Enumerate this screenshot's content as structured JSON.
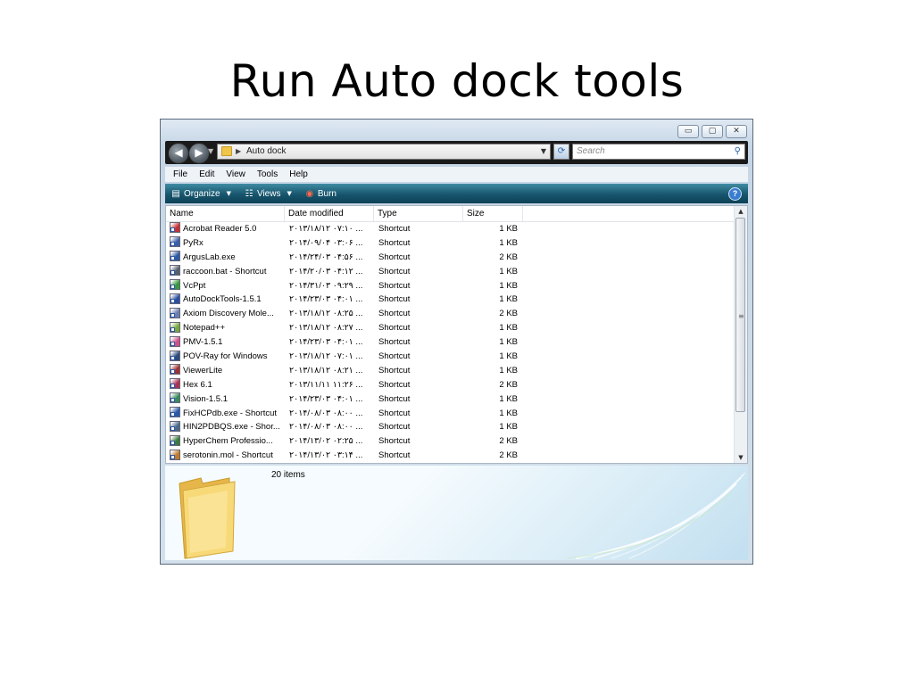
{
  "slide": {
    "title": "Run Auto dock tools"
  },
  "window": {
    "caption": {
      "minimize": "▭",
      "maximize": "▢",
      "close": "✕"
    },
    "nav": {
      "back_icon": "back-arrow-icon",
      "forward_icon": "forward-arrow-icon"
    },
    "address": {
      "path": "Auto dock"
    },
    "search": {
      "placeholder": "Search"
    },
    "menu": [
      "File",
      "Edit",
      "View",
      "Tools",
      "Help"
    ],
    "toolbar": {
      "organize": "Organize",
      "views": "Views",
      "burn": "Burn"
    },
    "columns": {
      "name": "Name",
      "date": "Date modified",
      "type": "Type",
      "size": "Size"
    },
    "files": [
      {
        "name": "Acrobat Reader 5.0",
        "date": "۲۰۱۳/۱۸/۱۲ ۰۷:۱۰ ...",
        "type": "Shortcut",
        "size": "1 KB",
        "color": "#c8302f"
      },
      {
        "name": "PyRx",
        "date": "۲۰۱۴/۰۹/۰۴ ۰۳:۰۶ ...",
        "type": "Shortcut",
        "size": "1 KB",
        "color": "#3b5fa8"
      },
      {
        "name": "ArgusLab.exe",
        "date": "۲۰۱۴/۲۴/۰۳ ۰۴:۵۶ ...",
        "type": "Shortcut",
        "size": "2 KB",
        "color": "#2c5aa0"
      },
      {
        "name": "raccoon.bat - Shortcut",
        "date": "۲۰۱۴/۲۰/۰۳ ۰۴:۱۲ ...",
        "type": "Shortcut",
        "size": "1 KB",
        "color": "#55606b"
      },
      {
        "name": "VcPpt",
        "date": "۲۰۱۴/۳۱/۰۳ ۰۹:۲۹ ...",
        "type": "Shortcut",
        "size": "1 KB",
        "color": "#3a9a3a"
      },
      {
        "name": "AutoDockTools-1.5.1",
        "date": "۲۰۱۴/۲۳/۰۳ ۰۴:۰۱ ...",
        "type": "Shortcut",
        "size": "1 KB",
        "color": "#2a4f9e"
      },
      {
        "name": "Axiom Discovery Mole...",
        "date": "۲۰۱۳/۱۸/۱۲ ۰۸:۲۵ ...",
        "type": "Shortcut",
        "size": "2 KB",
        "color": "#6a7fb0"
      },
      {
        "name": "Notepad++",
        "date": "۲۰۱۳/۱۸/۱۲ ۰۸:۲۷ ...",
        "type": "Shortcut",
        "size": "1 KB",
        "color": "#79a83a"
      },
      {
        "name": "PMV-1.5.1",
        "date": "۲۰۱۴/۲۳/۰۳ ۰۴:۰۱ ...",
        "type": "Shortcut",
        "size": "1 KB",
        "color": "#d0508a"
      },
      {
        "name": "POV-Ray for Windows",
        "date": "۲۰۱۳/۱۸/۱۲ ۰۷:۰۱ ...",
        "type": "Shortcut",
        "size": "1 KB",
        "color": "#2b4a7a"
      },
      {
        "name": "ViewerLite",
        "date": "۲۰۱۳/۱۸/۱۲ ۰۸:۲۱ ...",
        "type": "Shortcut",
        "size": "1 KB",
        "color": "#a0302f"
      },
      {
        "name": "Hex 6.1",
        "date": "۲۰۱۳/۱۱/۱۱ ۱۱:۲۶ ...",
        "type": "Shortcut",
        "size": "2 KB",
        "color": "#b03050"
      },
      {
        "name": "Vision-1.5.1",
        "date": "۲۰۱۴/۲۳/۰۳ ۰۴:۰۱ ...",
        "type": "Shortcut",
        "size": "1 KB",
        "color": "#3a8a5a"
      },
      {
        "name": "FixHCPdb.exe - Shortcut",
        "date": "۲۰۱۴/۰۸/۰۳ ۰۸:۰۰ ...",
        "type": "Shortcut",
        "size": "1 KB",
        "color": "#2a5aa8"
      },
      {
        "name": "HIN2PDBQS.exe - Shor...",
        "date": "۲۰۱۴/۰۸/۰۳ ۰۸:۰۰ ...",
        "type": "Shortcut",
        "size": "1 KB",
        "color": "#4a6a8a"
      },
      {
        "name": "HyperChem Professio...",
        "date": "۲۰۱۴/۱۳/۰۲ ۰۲:۲۵ ...",
        "type": "Shortcut",
        "size": "2 KB",
        "color": "#3a7a3a"
      },
      {
        "name": "serotonin.mol - Shortcut",
        "date": "۲۰۱۴/۱۳/۰۲ ۰۳:۱۴ ...",
        "type": "Shortcut",
        "size": "2 KB",
        "color": "#c07a2a"
      }
    ],
    "status": {
      "items": "20 items"
    }
  }
}
